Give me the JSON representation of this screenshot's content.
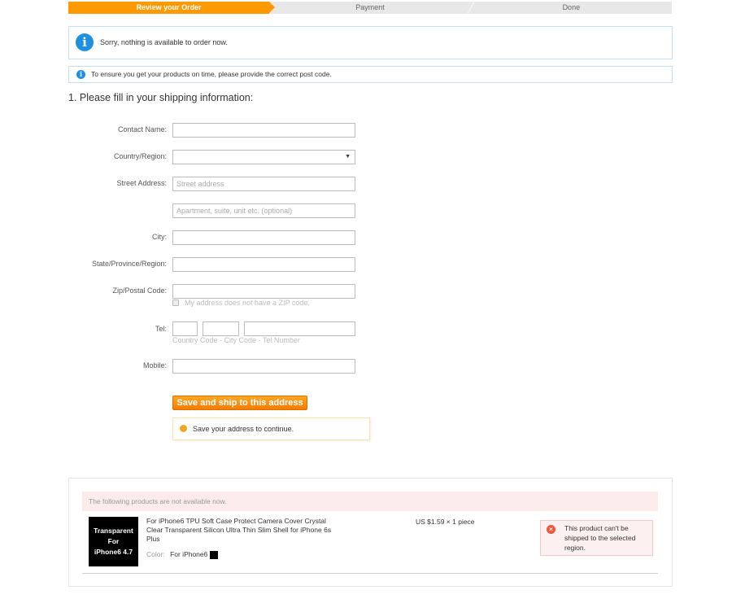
{
  "steps": [
    "Review your Order",
    "Payment",
    "Done"
  ],
  "notice_main": "Sorry, nothing is available to order now.",
  "notice_post": "To ensure you get your products on time, please provide the correct post code.",
  "heading": "1. Please fill in your shipping information:",
  "form": {
    "contact_name": "Contact Name:",
    "country": "Country/Region:",
    "street": "Street Address:",
    "street_placeholder": "Street address",
    "apt_placeholder": "Apartment, suite, unit etc. (optional)",
    "city": "City:",
    "state": "State/Province/Region:",
    "zip": "Zip/Postal Code:",
    "no_zip": "My address does not have a ZIP code.",
    "tel": "Tel:",
    "tel_hint": "Country Code - City Code - Tel Number",
    "mobile": "Mobile:",
    "save_button": "Save and ship to this address",
    "tip": "Save your address to continue."
  },
  "unavailable": {
    "banner": "The following products are not available now.",
    "product": {
      "image_text": [
        "Transparent",
        "For",
        "iPhone6 4.7"
      ],
      "title": "For iPhone6 TPU Soft Case Protect Camera Cover Crystal Clear Transparent Silicon Ultra Thin Slim Shell for iPhone 6s Plus",
      "color_label": "Color:",
      "color_value": "For iPhone6",
      "price": "US $1.59 × 1 piece",
      "error": "This product can't be shipped to the selected region."
    }
  }
}
